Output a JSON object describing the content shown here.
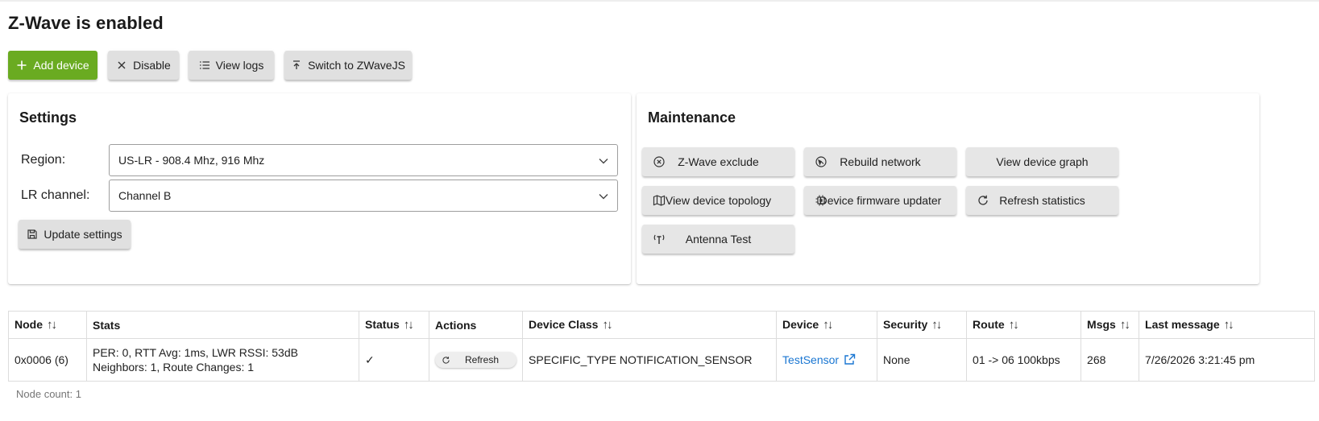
{
  "page": {
    "title": "Z-Wave is enabled"
  },
  "toolbar": {
    "add_device": "Add device",
    "disable": "Disable",
    "view_logs": "View logs",
    "switch": "Switch to ZWaveJS"
  },
  "settings": {
    "title": "Settings",
    "region_label": "Region:",
    "region_value": "US-LR - 908.4 Mhz, 916 Mhz",
    "lr_label": "LR channel:",
    "lr_value": "Channel B",
    "update_label": "Update settings"
  },
  "maintenance": {
    "title": "Maintenance",
    "buttons": [
      {
        "label": "Z-Wave exclude",
        "icon": "x-circle-icon"
      },
      {
        "label": "Rebuild network",
        "icon": "rebuild-icon"
      },
      {
        "label": "View device graph",
        "icon": ""
      },
      {
        "label": "View device topology",
        "icon": "map-icon"
      },
      {
        "label": "Device firmware updater",
        "icon": "chip-icon"
      },
      {
        "label": "Refresh statistics",
        "icon": "refresh-icon"
      },
      {
        "label": "Antenna Test",
        "icon": "antenna-icon"
      }
    ]
  },
  "table": {
    "headers": {
      "node": "Node",
      "stats": "Stats",
      "status": "Status",
      "actions": "Actions",
      "device_class": "Device Class",
      "device": "Device",
      "security": "Security",
      "route": "Route",
      "msgs": "Msgs",
      "last_message": "Last message"
    },
    "rows": [
      {
        "node": "0x0006 (6)",
        "stats_line1": "PER: 0, RTT Avg: 1ms, LWR RSSI: 53dB",
        "stats_line2": "Neighbors: 1, Route Changes: 1",
        "status": "✓",
        "action": "Refresh",
        "device_class": "SPECIFIC_TYPE NOTIFICATION_SENSOR",
        "device": "TestSensor",
        "security": "None",
        "route": "01 -> 06 100kbps",
        "msgs": "268",
        "last_message": "7/26/2026 3:21:45 pm"
      }
    ],
    "sort_glyph": "↑↓"
  },
  "footer": {
    "node_count": "Node count: 1"
  },
  "colors": {
    "accent_green": "#6aab21",
    "link_blue": "#1976d2",
    "button_gray": "#e0e0e0"
  }
}
